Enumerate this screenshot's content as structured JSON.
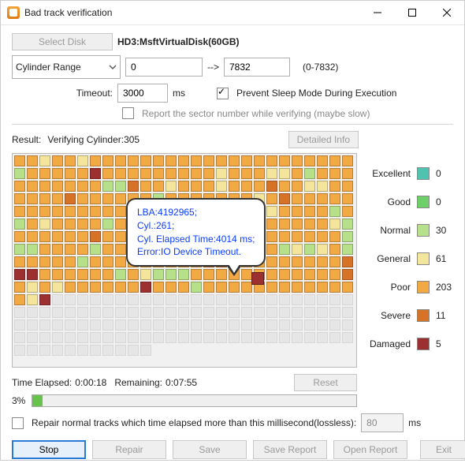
{
  "window": {
    "title": "Bad track verification"
  },
  "toolbar": {
    "selectDisk": "Select Disk",
    "diskName": "HD3:MsftVirtualDisk(60GB)",
    "rangeMode": "Cylinder Range",
    "rangeFrom": "0",
    "rangeArrow": "-->",
    "rangeTo": "7832",
    "rangeHint": "(0-7832)",
    "timeoutLabel": "Timeout:",
    "timeoutVal": "3000",
    "timeoutUnit": "ms",
    "preventSleep": "Prevent Sleep Mode During Execution",
    "reportSector": "Report the sector number while verifying (maybe slow)"
  },
  "result": {
    "label": "Result:",
    "status": "Verifying Cylinder:305",
    "detailBtn": "Detailed Info"
  },
  "legend": {
    "excellent": {
      "label": "Excellent",
      "count": "0"
    },
    "good": {
      "label": "Good",
      "count": "0"
    },
    "normal": {
      "label": "Normal",
      "count": "30"
    },
    "general": {
      "label": "General",
      "count": "61"
    },
    "poor": {
      "label": "Poor",
      "count": "203"
    },
    "severe": {
      "label": "Severe",
      "count": "11"
    },
    "damaged": {
      "label": "Damaged",
      "count": "5"
    }
  },
  "tooltip": {
    "l1": "LBA:4192965;",
    "l2": "Cyl.:261;",
    "l3": "Cyl. Elapsed Time:4014 ms;",
    "l4": "Error:IO Device Timeout."
  },
  "timer": {
    "elapsedLabel": "Time Elapsed:",
    "elapsedVal": "0:00:18",
    "remainLabel": "Remaining:",
    "remainVal": "0:07:55",
    "resetBtn": "Reset",
    "pct": "3%"
  },
  "repair": {
    "label": "Repair normal tracks which time elapsed more than this millisecond(lossless):",
    "val": "80",
    "unit": "ms"
  },
  "buttons": {
    "stop": "Stop",
    "repair": "Repair",
    "save": "Save",
    "saveReport": "Save Report",
    "openReport": "Open Report",
    "exit": "Exit"
  },
  "grid": {
    "cols": 26,
    "rows": 16,
    "pattern": "ppgppgpppppppppppppppppppppnpppppdpppppppppgpppggpnppppppppppnnsppgpppgpppsppggppppppsppppppnpppppppgpsppppppppppppppnppppnpppppgppppnpnpgppppnppppnpppppsppppppgnppppppspppppppppppppppppppnnnppppnppsppppgpnppgpngngpnpppppnpppppppppsspppppppppsddppppppnpgnnnppppppppppppspgpgppppppdpppnpppppppppppppgd............................................................................................................................................................................................................................................................................................................................................................................................................................................................................................................................................................................................................................................................................................................................................................................................................................................................................................................................................................................................................................................................................................................................................................................................................................................................................................................................................................................................................................................................................................................................................................................................................................................................................................................................................................................................................................................................................................................................................................................................................................................................................................................................................................................................................................................................................................................................................................................................................................................................................................................................................................................................................................................................................................................................................................................................................................................................................................................................"
  }
}
